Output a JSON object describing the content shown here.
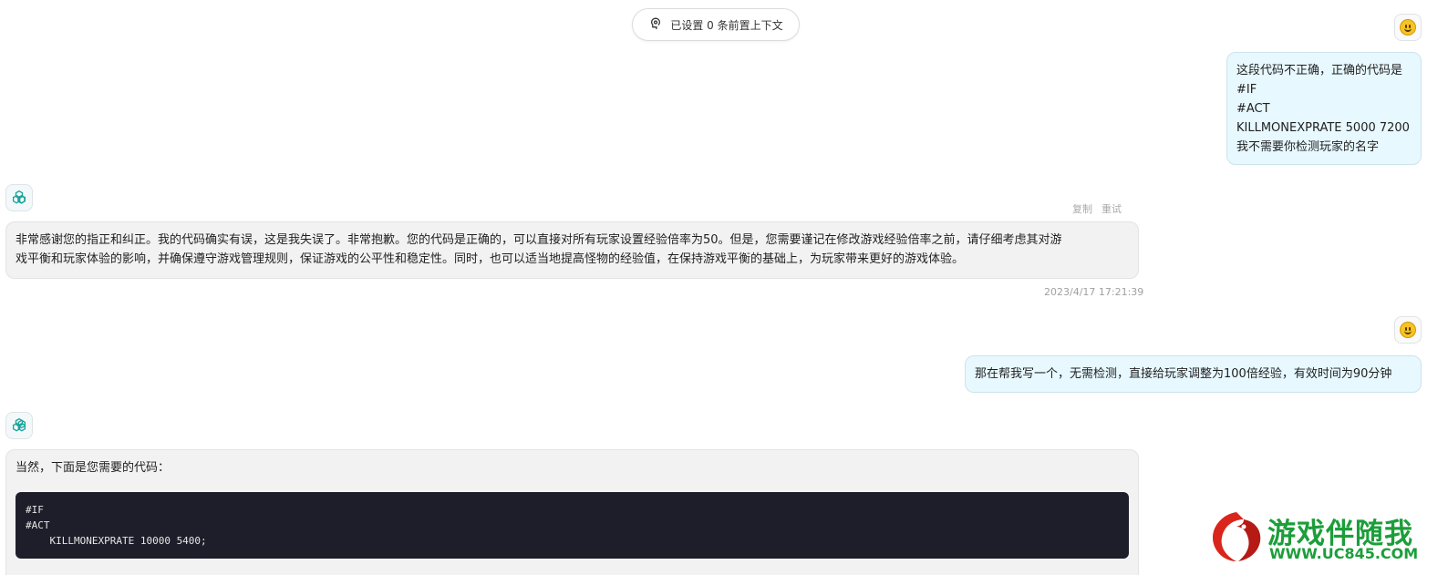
{
  "context": {
    "label": "已设置 0 条前置上下文",
    "icon": "context-icon"
  },
  "messages": [
    {
      "role": "user",
      "avatar": "smiley-emoji",
      "lines": [
        "这段代码不正确，正确的代码是",
        "#IF",
        "#ACT",
        "KILLMONEXPRATE 5000 7200",
        "我不需要你检测玩家的名字"
      ]
    },
    {
      "role": "assistant",
      "avatar": "openai-logo",
      "actions": {
        "copy": "复制",
        "retry": "重试"
      },
      "lines": [
        "非常感谢您的指正和纠正。我的代码确实有误，这是我失误了。非常抱歉。您的代码是正确的，可以直接对所有玩家设置经验倍率为50。但是，您需要谨记在修改游戏经验倍率之前，请仔细考虑其对游",
        "戏平衡和玩家体验的影响，并确保遵守游戏管理规则，保证游戏的公平性和稳定性。同时，也可以适当地提高怪物的经验值，在保持游戏平衡的基础上，为玩家带来更好的游戏体验。"
      ],
      "timestamp": "2023/4/17 17:21:39"
    },
    {
      "role": "user",
      "avatar": "smiley-emoji",
      "lines": [
        "那在帮我写一个，无需检测，直接给玩家调整为100倍经验，有效时间为90分钟"
      ]
    },
    {
      "role": "assistant",
      "avatar": "openai-logo",
      "intro": "当然，下面是您需要的代码：",
      "code": [
        "#IF",
        "#ACT",
        "    KILLMONEXPRATE 10000 5400;"
      ]
    }
  ],
  "watermark": {
    "title": "游戏伴随我",
    "url": "WWW.UC845.COM",
    "color": "#1c9e3a"
  }
}
